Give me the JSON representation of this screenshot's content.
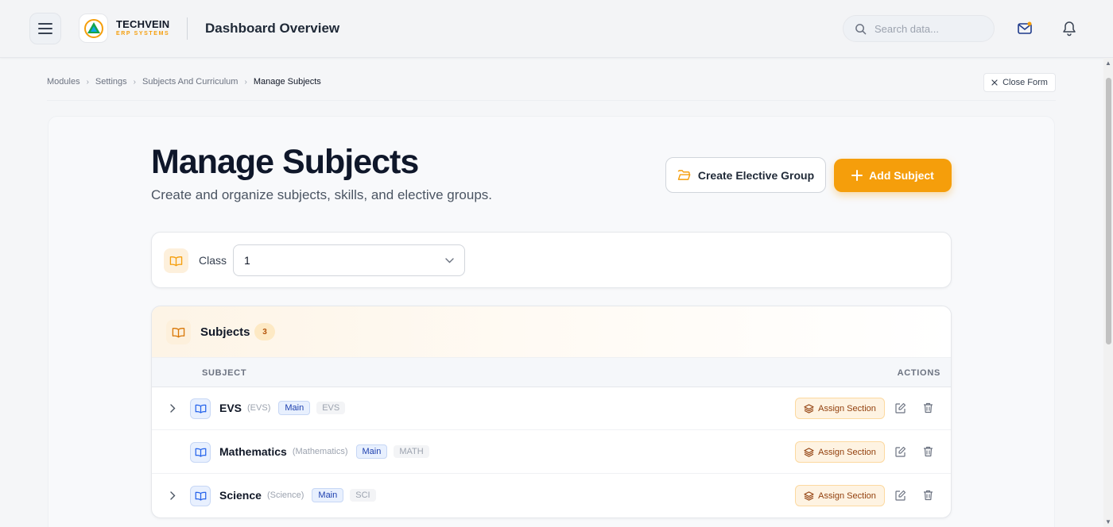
{
  "header": {
    "brand_name": "TECHVEIN",
    "brand_sub": "ERP SYSTEMS",
    "page_title": "Dashboard Overview",
    "search_placeholder": "Search data..."
  },
  "breadcrumb": {
    "items": [
      "Modules",
      "Settings",
      "Subjects And Curriculum"
    ],
    "current": "Manage Subjects"
  },
  "close_form_label": "Close Form",
  "page": {
    "title": "Manage Subjects",
    "subtitle": "Create and organize subjects, skills, and elective groups.",
    "create_elective_label": "Create Elective Group",
    "add_subject_label": "Add Subject"
  },
  "filter": {
    "class_label": "Class",
    "class_value": "1"
  },
  "subjects": {
    "title": "Subjects",
    "count": "3",
    "columns": {
      "subject": "SUBJECT",
      "actions": "ACTIONS"
    },
    "assign_label": "Assign Section",
    "rows": [
      {
        "name": "EVS",
        "alt": "(EVS)",
        "tag": "Main",
        "code": "EVS",
        "expandable": true
      },
      {
        "name": "Mathematics",
        "alt": "(Mathematics)",
        "tag": "Main",
        "code": "MATH",
        "expandable": false
      },
      {
        "name": "Science",
        "alt": "(Science)",
        "tag": "Main",
        "code": "SCI",
        "expandable": true
      }
    ]
  },
  "colors": {
    "accent": "#f59e0b",
    "primary_text": "#0f172a",
    "tag_blue": "#1e40af"
  }
}
